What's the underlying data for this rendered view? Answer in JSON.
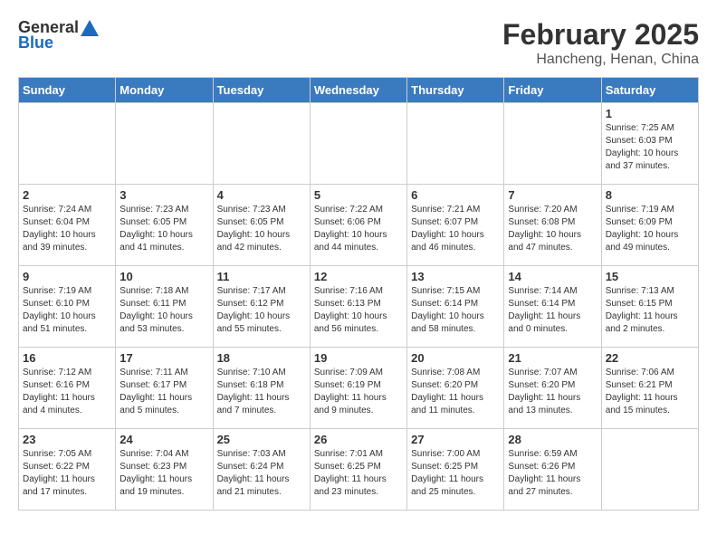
{
  "logo": {
    "general": "General",
    "blue": "Blue"
  },
  "title": "February 2025",
  "subtitle": "Hancheng, Henan, China",
  "days_of_week": [
    "Sunday",
    "Monday",
    "Tuesday",
    "Wednesday",
    "Thursday",
    "Friday",
    "Saturday"
  ],
  "weeks": [
    [
      {
        "day": "",
        "info": ""
      },
      {
        "day": "",
        "info": ""
      },
      {
        "day": "",
        "info": ""
      },
      {
        "day": "",
        "info": ""
      },
      {
        "day": "",
        "info": ""
      },
      {
        "day": "",
        "info": ""
      },
      {
        "day": "1",
        "info": "Sunrise: 7:25 AM\nSunset: 6:03 PM\nDaylight: 10 hours and 37 minutes."
      }
    ],
    [
      {
        "day": "2",
        "info": "Sunrise: 7:24 AM\nSunset: 6:04 PM\nDaylight: 10 hours and 39 minutes."
      },
      {
        "day": "3",
        "info": "Sunrise: 7:23 AM\nSunset: 6:05 PM\nDaylight: 10 hours and 41 minutes."
      },
      {
        "day": "4",
        "info": "Sunrise: 7:23 AM\nSunset: 6:05 PM\nDaylight: 10 hours and 42 minutes."
      },
      {
        "day": "5",
        "info": "Sunrise: 7:22 AM\nSunset: 6:06 PM\nDaylight: 10 hours and 44 minutes."
      },
      {
        "day": "6",
        "info": "Sunrise: 7:21 AM\nSunset: 6:07 PM\nDaylight: 10 hours and 46 minutes."
      },
      {
        "day": "7",
        "info": "Sunrise: 7:20 AM\nSunset: 6:08 PM\nDaylight: 10 hours and 47 minutes."
      },
      {
        "day": "8",
        "info": "Sunrise: 7:19 AM\nSunset: 6:09 PM\nDaylight: 10 hours and 49 minutes."
      }
    ],
    [
      {
        "day": "9",
        "info": "Sunrise: 7:19 AM\nSunset: 6:10 PM\nDaylight: 10 hours and 51 minutes."
      },
      {
        "day": "10",
        "info": "Sunrise: 7:18 AM\nSunset: 6:11 PM\nDaylight: 10 hours and 53 minutes."
      },
      {
        "day": "11",
        "info": "Sunrise: 7:17 AM\nSunset: 6:12 PM\nDaylight: 10 hours and 55 minutes."
      },
      {
        "day": "12",
        "info": "Sunrise: 7:16 AM\nSunset: 6:13 PM\nDaylight: 10 hours and 56 minutes."
      },
      {
        "day": "13",
        "info": "Sunrise: 7:15 AM\nSunset: 6:14 PM\nDaylight: 10 hours and 58 minutes."
      },
      {
        "day": "14",
        "info": "Sunrise: 7:14 AM\nSunset: 6:14 PM\nDaylight: 11 hours and 0 minutes."
      },
      {
        "day": "15",
        "info": "Sunrise: 7:13 AM\nSunset: 6:15 PM\nDaylight: 11 hours and 2 minutes."
      }
    ],
    [
      {
        "day": "16",
        "info": "Sunrise: 7:12 AM\nSunset: 6:16 PM\nDaylight: 11 hours and 4 minutes."
      },
      {
        "day": "17",
        "info": "Sunrise: 7:11 AM\nSunset: 6:17 PM\nDaylight: 11 hours and 5 minutes."
      },
      {
        "day": "18",
        "info": "Sunrise: 7:10 AM\nSunset: 6:18 PM\nDaylight: 11 hours and 7 minutes."
      },
      {
        "day": "19",
        "info": "Sunrise: 7:09 AM\nSunset: 6:19 PM\nDaylight: 11 hours and 9 minutes."
      },
      {
        "day": "20",
        "info": "Sunrise: 7:08 AM\nSunset: 6:20 PM\nDaylight: 11 hours and 11 minutes."
      },
      {
        "day": "21",
        "info": "Sunrise: 7:07 AM\nSunset: 6:20 PM\nDaylight: 11 hours and 13 minutes."
      },
      {
        "day": "22",
        "info": "Sunrise: 7:06 AM\nSunset: 6:21 PM\nDaylight: 11 hours and 15 minutes."
      }
    ],
    [
      {
        "day": "23",
        "info": "Sunrise: 7:05 AM\nSunset: 6:22 PM\nDaylight: 11 hours and 17 minutes."
      },
      {
        "day": "24",
        "info": "Sunrise: 7:04 AM\nSunset: 6:23 PM\nDaylight: 11 hours and 19 minutes."
      },
      {
        "day": "25",
        "info": "Sunrise: 7:03 AM\nSunset: 6:24 PM\nDaylight: 11 hours and 21 minutes."
      },
      {
        "day": "26",
        "info": "Sunrise: 7:01 AM\nSunset: 6:25 PM\nDaylight: 11 hours and 23 minutes."
      },
      {
        "day": "27",
        "info": "Sunrise: 7:00 AM\nSunset: 6:25 PM\nDaylight: 11 hours and 25 minutes."
      },
      {
        "day": "28",
        "info": "Sunrise: 6:59 AM\nSunset: 6:26 PM\nDaylight: 11 hours and 27 minutes."
      },
      {
        "day": "",
        "info": ""
      }
    ]
  ]
}
